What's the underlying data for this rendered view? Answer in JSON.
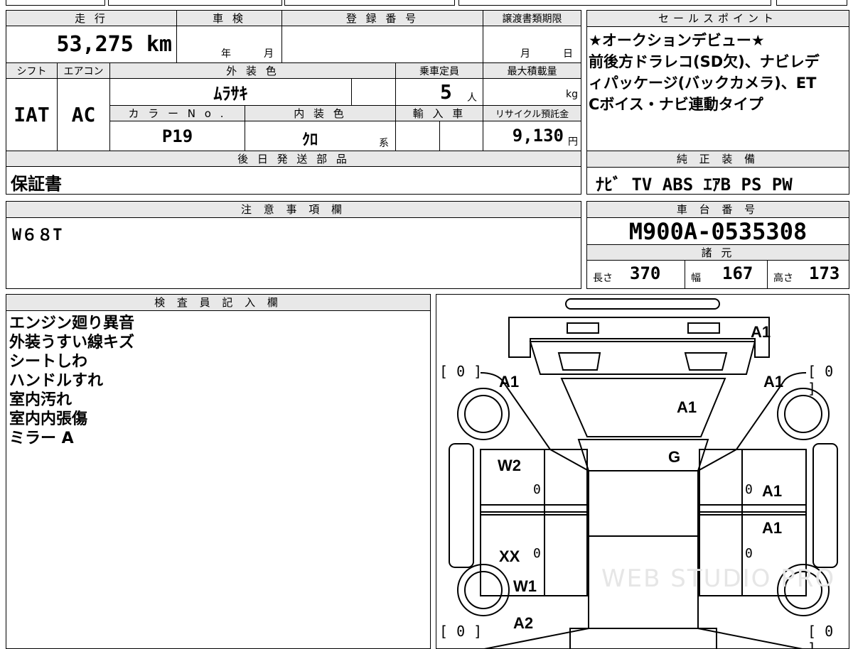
{
  "top_strip": {
    "partial_1": "",
    "partial_2": ""
  },
  "vehicle": {
    "mileage_label": "走 行",
    "mileage_value": "53,275 km",
    "shaken_label": "車 検",
    "shaken_year_suffix": "年",
    "shaken_month_suffix": "月",
    "registration_label": "登 録 番 号",
    "transfer_deadline_label": "譲渡書類期限",
    "transfer_month_suffix": "月",
    "transfer_day_suffix": "日",
    "shift_label": "シフト",
    "shift_value": "IAT",
    "ac_label": "エアコン",
    "ac_value": "AC",
    "exterior_color_label": "外 装 色",
    "exterior_color_value": "ﾑﾗｻｷ",
    "capacity_label": "乗車定員",
    "capacity_value": "5",
    "capacity_unit": "人",
    "max_load_label": "最大積載量",
    "max_load_unit": "kg",
    "color_no_label": "カ ラ ー N o .",
    "color_no_value": "P19",
    "interior_color_label": "内 装 色",
    "interior_color_value": "ｸﾛ",
    "interior_color_suffix": "系",
    "import_label": "輸 入 車",
    "recycle_label": "リサイクル預託金",
    "recycle_value": "9,130",
    "recycle_unit": "円",
    "later_parts_label": "後 日 発 送 部 品",
    "later_parts_value": "保証書"
  },
  "sales_point": {
    "label": "セールスポイント",
    "lines": [
      "★オークションデビュー★",
      "前後方ドラレコ(SD欠)、ナビレデ",
      "ィパッケージ(バックカメラ)、ET",
      "Cボイス・ナビ連動タイプ"
    ]
  },
  "genuine_equipment": {
    "label": "純 正 装 備",
    "value": "ﾅﾋﾞ TV ABS ｴｱB PS PW"
  },
  "caution": {
    "label": "注 意 事 項 欄",
    "value": "W６８T"
  },
  "chassis": {
    "label": "車 台 番 号",
    "value": "M900A-0535308"
  },
  "specs": {
    "label": "諸 元",
    "length_label": "長さ",
    "length_value": "370",
    "width_label": "幅",
    "width_value": "167",
    "height_label": "高さ",
    "height_value": "173"
  },
  "inspector": {
    "label": "検 査 員 記 入 欄",
    "notes": [
      "エンジン廻り異音",
      "外装うすい線キズ",
      "シートしわ",
      "ハンドルすれ",
      "室内汚れ",
      "室内内張傷",
      "ミラー A"
    ]
  },
  "diagram": {
    "tire_tl": "[ 0 ]",
    "tire_tr": "[ 0 ]",
    "tire_bl": "[ 0 ]",
    "tire_br": "[ 0 ]",
    "damage": {
      "front_bumper": "A1",
      "front_left_fender": "A1",
      "front_right_fender": "A1",
      "hood": "A1",
      "windshield": "G",
      "left_front_door": "W2",
      "right_front_door": "A1",
      "right_rear_door": "A1",
      "left_rear_door": "XX",
      "left_rear_quarter": "W1",
      "rear_left": "A2"
    },
    "ticks": {
      "lf": "0",
      "lr": "0",
      "rf": "0",
      "rr": "0"
    },
    "watermark": "WEB STUDIO PRO"
  }
}
